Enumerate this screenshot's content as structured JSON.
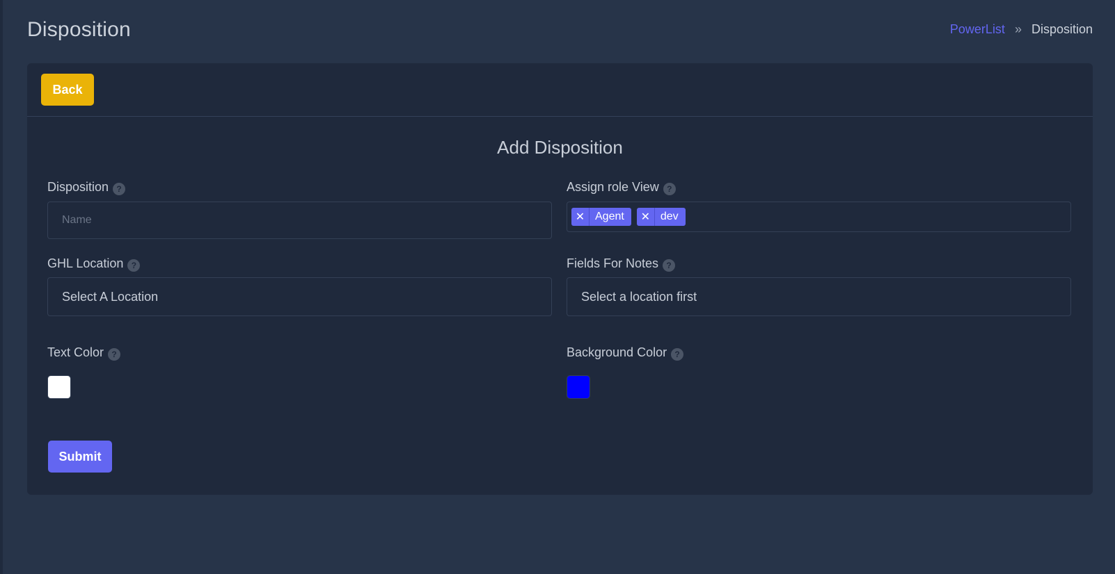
{
  "header": {
    "title": "Disposition",
    "breadcrumb": {
      "link": "PowerList",
      "separator": "»",
      "current": "Disposition"
    }
  },
  "card": {
    "back_label": "Back",
    "form_title": "Add Disposition",
    "help_glyph": "?",
    "fields": {
      "disposition": {
        "label": "Disposition",
        "placeholder": "Name",
        "value": ""
      },
      "assign_role": {
        "label": "Assign role View",
        "tags": [
          {
            "remove": "✕",
            "label": "Agent"
          },
          {
            "remove": "✕",
            "label": "dev"
          }
        ]
      },
      "ghl_location": {
        "label": "GHL Location",
        "value": "Select A Location"
      },
      "fields_for_notes": {
        "label": "Fields For Notes",
        "value": "Select a location first"
      },
      "text_color": {
        "label": "Text Color",
        "value": "#ffffff"
      },
      "background_color": {
        "label": "Background Color",
        "value": "#0000ff"
      }
    },
    "submit_label": "Submit"
  },
  "colors": {
    "page_bg": "#273449",
    "card_bg": "#1f293c",
    "accent": "#6366f1",
    "back_button": "#eab308"
  }
}
